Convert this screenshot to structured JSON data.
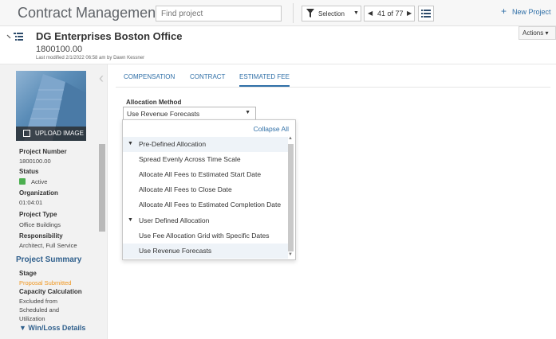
{
  "topbar": {
    "app_title": "Contract Management",
    "search_placeholder": "Find project",
    "selection_label": "Selection",
    "pager_text": "41 of 77",
    "new_project_label": "New Project"
  },
  "header": {
    "project_title": "DG Enterprises Boston Office",
    "project_number": "1800100.00",
    "last_modified": "Last modified 2/1/2022 06:58 am by Dawn Kessner",
    "actions_label": "Actions ▾"
  },
  "sidebar": {
    "upload_label": "UPLOAD IMAGE",
    "fields": {
      "project_number_label": "Project Number",
      "project_number_value": "1800100.00",
      "status_label": "Status",
      "status_value": "Active",
      "organization_label": "Organization",
      "organization_value": "01:04:01",
      "project_type_label": "Project Type",
      "project_type_value": "Office Buildings",
      "responsibility_label": "Responsibility",
      "responsibility_value": "Architect, Full Service"
    },
    "project_summary_label": "Project Summary",
    "stage_label": "Stage",
    "stage_value": "Proposal Submitted",
    "capacity_label": "Capacity Calculation",
    "capacity_value_1": "Excluded from",
    "capacity_value_2": "Scheduled and",
    "capacity_value_3": "Utilization",
    "winloss_label": "Win/Loss Details"
  },
  "tabs": [
    {
      "label": "COMPENSATION"
    },
    {
      "label": "CONTRACT"
    },
    {
      "label": "ESTIMATED FEE"
    }
  ],
  "allocation": {
    "label": "Allocation Method",
    "selected": "Use Revenue Forecasts",
    "collapse_all": "Collapse All",
    "groups": [
      {
        "label": "Pre-Defined Allocation",
        "options": [
          "Spread Evenly Across Time Scale",
          "Allocate All Fees to Estimated Start Date",
          "Allocate All Fees to Close Date",
          "Allocate All Fees to Estimated Completion Date"
        ]
      },
      {
        "label": "User Defined Allocation",
        "options": [
          "Use Fee Allocation Grid with Specific Dates",
          "Use Revenue Forecasts"
        ]
      }
    ]
  },
  "colors": {
    "accent": "#2f6fa7",
    "status_active": "#4caf50",
    "stage_value": "#f0961e"
  }
}
